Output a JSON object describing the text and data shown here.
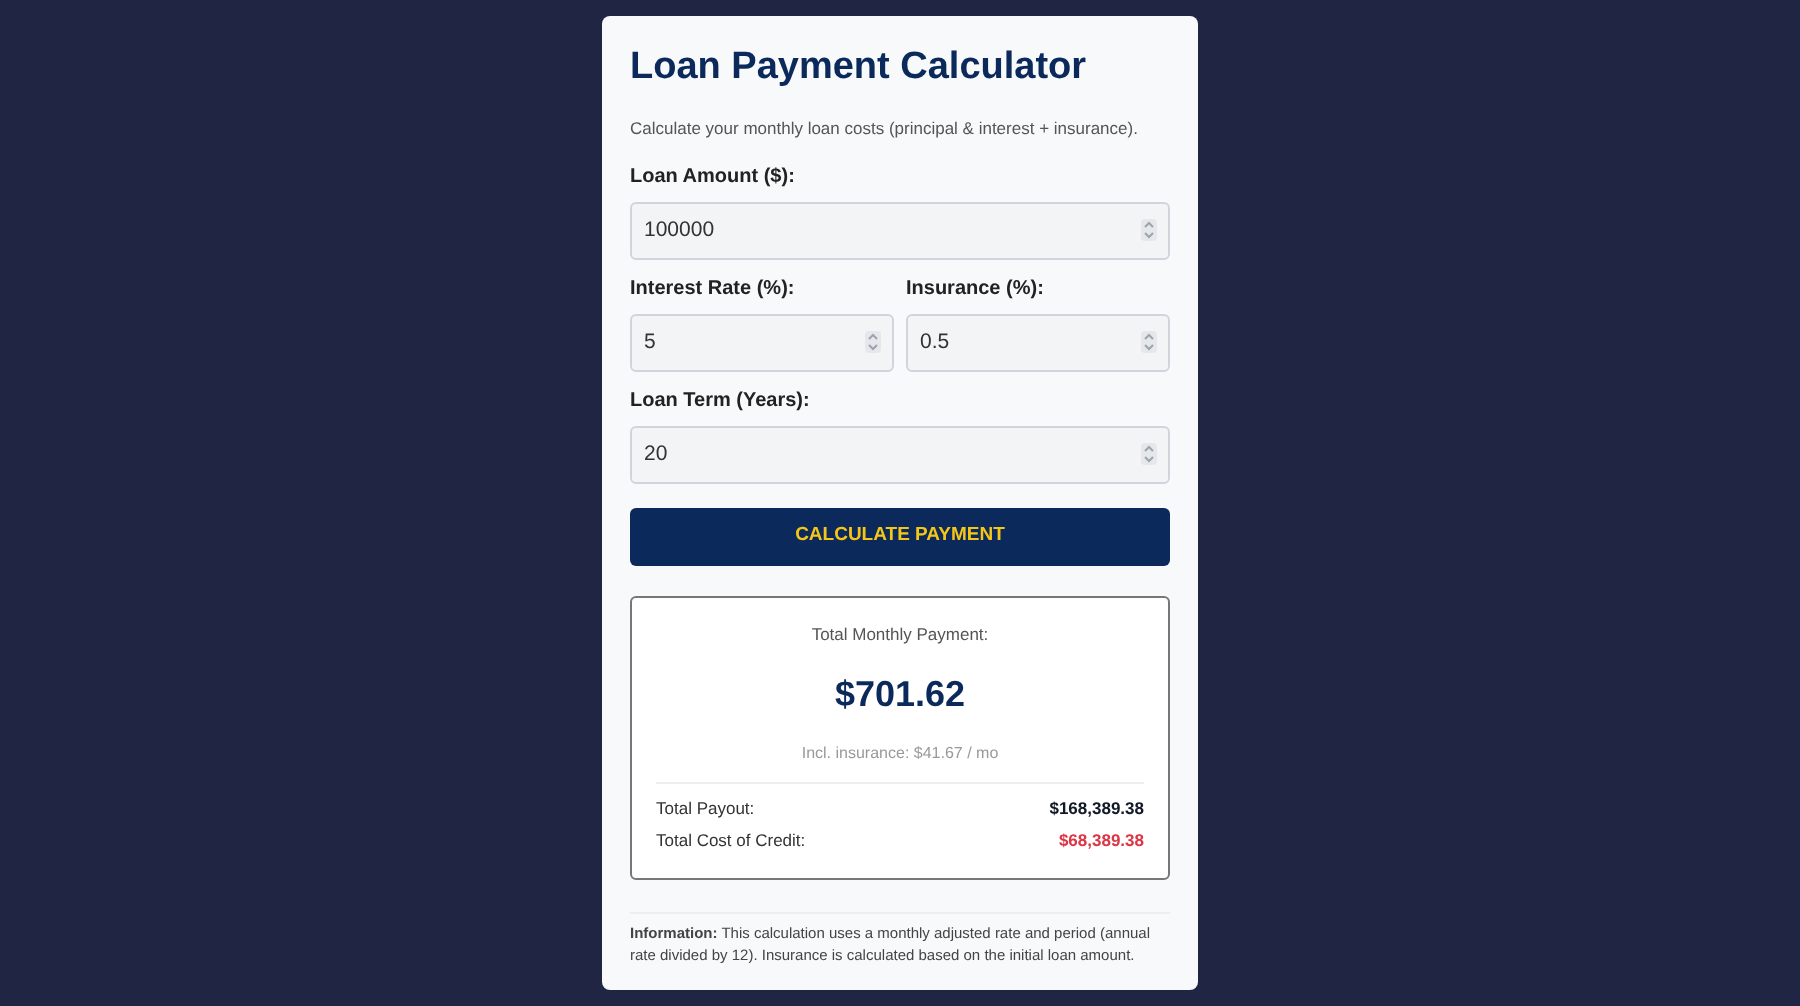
{
  "title": "Loan Payment Calculator",
  "subtitle": "Calculate your monthly loan costs (principal & interest + insurance).",
  "field_rows": [
    [
      {
        "label": "Loan Amount ($):",
        "value": "100000"
      }
    ],
    [
      {
        "label": "Interest Rate (%):",
        "value": "5"
      },
      {
        "label": "Insurance (%):",
        "value": "0.5"
      }
    ],
    [
      {
        "label": "Loan Term (Years):",
        "value": "20"
      }
    ]
  ],
  "button": "CALCULATE PAYMENT",
  "result": {
    "heading": "Total Monthly Payment:",
    "amount": "$701.62",
    "note": "Incl. insurance: $41.67 / mo",
    "lines": [
      {
        "label": "Total Payout:",
        "value": "$168,389.38",
        "color": "#111827"
      },
      {
        "label": "Total Cost of Credit:",
        "value": "$68,389.38",
        "color": "#dc3545"
      }
    ]
  },
  "info": "**Information:** This calculation uses a monthly adjusted rate and period (annual rate divided by 12). Insurance is calculated based on the initial loan amount."
}
